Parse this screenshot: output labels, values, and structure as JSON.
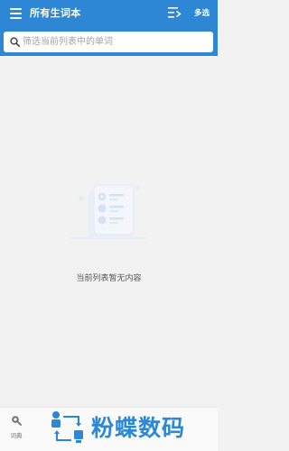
{
  "app_bar": {
    "title": "所有生词本",
    "menu_icon": "menu-icon",
    "sort_icon": "list-sort-icon",
    "multi_select_label": "多选",
    "color": "#2d87d4"
  },
  "search": {
    "placeholder": "筛选当前列表中的单词",
    "value": "",
    "icon": "search-icon"
  },
  "empty_state": {
    "message": "当前列表暂无内容",
    "illustration": "empty-list-illustration"
  },
  "bottom_nav": {
    "items": [
      {
        "label": "词典",
        "icon": "dictionary-search-icon"
      }
    ]
  },
  "watermark": {
    "text": "粉蝶数码",
    "logo": "watermark-logo"
  }
}
